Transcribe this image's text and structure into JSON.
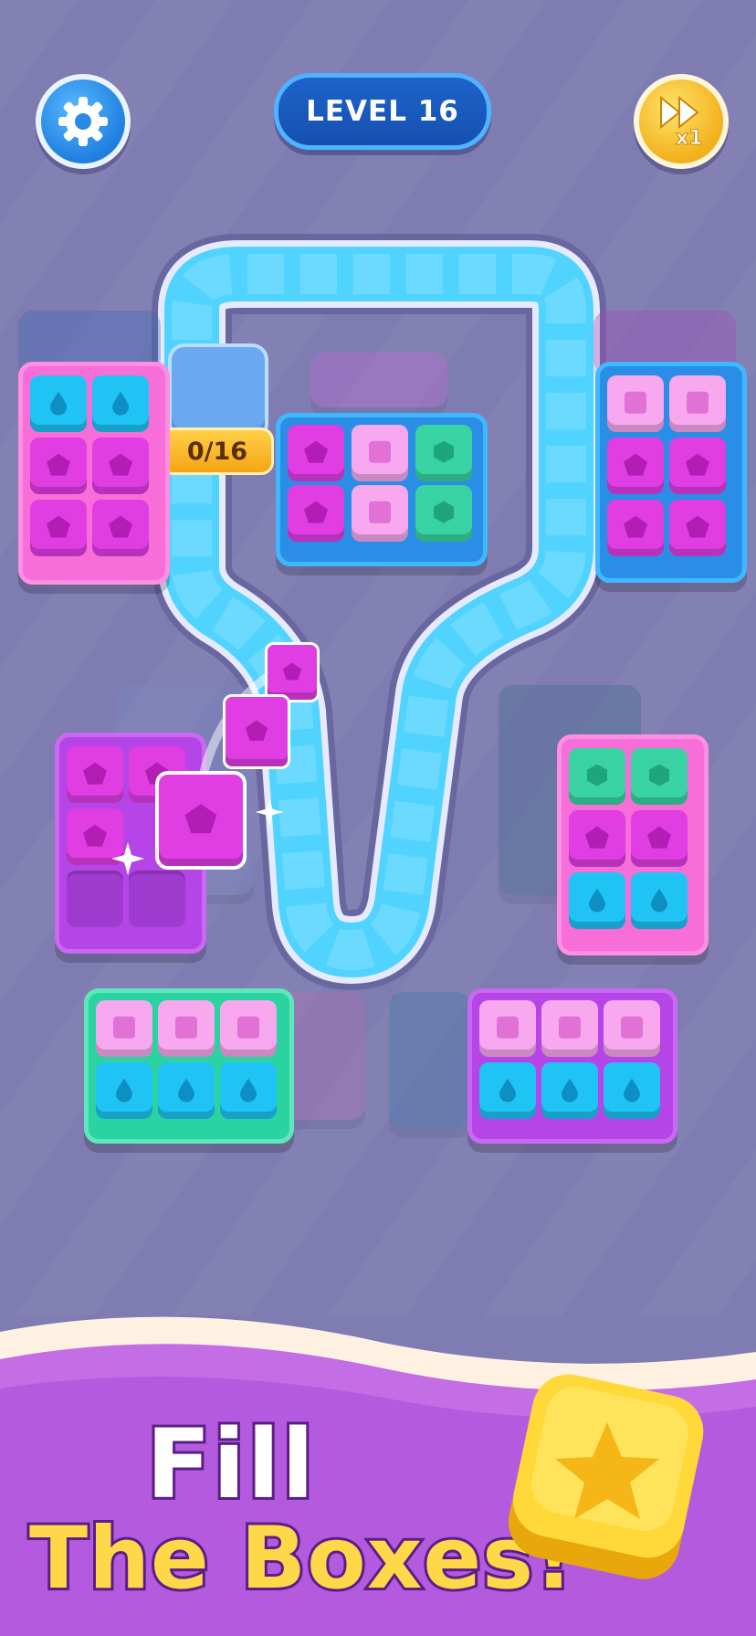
{
  "hud": {
    "level_label": "LEVEL 16",
    "speed_label": "x1",
    "counter": "0/16",
    "settings_icon": "gear-icon",
    "speed_icon": "fast-forward-icon"
  },
  "banner": {
    "line1": "Fill",
    "line2": "The Boxes!",
    "star_icon": "star-icon"
  },
  "colors": {
    "background": "#7f7cb2",
    "blue": "#20c4f4",
    "magenta": "#e03de3",
    "pink": "#f7a8ee",
    "green": "#39d3a3",
    "purple": "#b545e6",
    "gold": "#ffd84a"
  }
}
